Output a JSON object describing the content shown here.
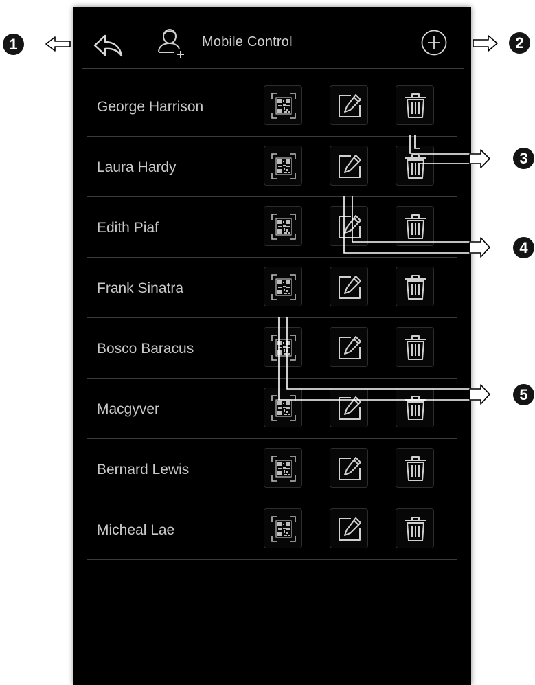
{
  "header": {
    "title": "Mobile Control",
    "back_icon": "back-arrow-icon",
    "user_icon": "add-user-icon",
    "add_icon": "plus-circle-icon"
  },
  "contacts": [
    {
      "name": "George Harrison"
    },
    {
      "name": "Laura Hardy"
    },
    {
      "name": "Edith Piaf"
    },
    {
      "name": "Frank Sinatra"
    },
    {
      "name": "Bosco Baracus"
    },
    {
      "name": "Macgyver"
    },
    {
      "name": "Bernard Lewis"
    },
    {
      "name": "Micheal Lae"
    }
  ],
  "row_actions": [
    "qr-code-icon",
    "edit-icon",
    "trash-icon"
  ],
  "callouts": [
    "1",
    "2",
    "3",
    "4",
    "5"
  ],
  "colors": {
    "background": "#000000",
    "text": "#c9c9c9",
    "divider": "#3a3a3a"
  }
}
